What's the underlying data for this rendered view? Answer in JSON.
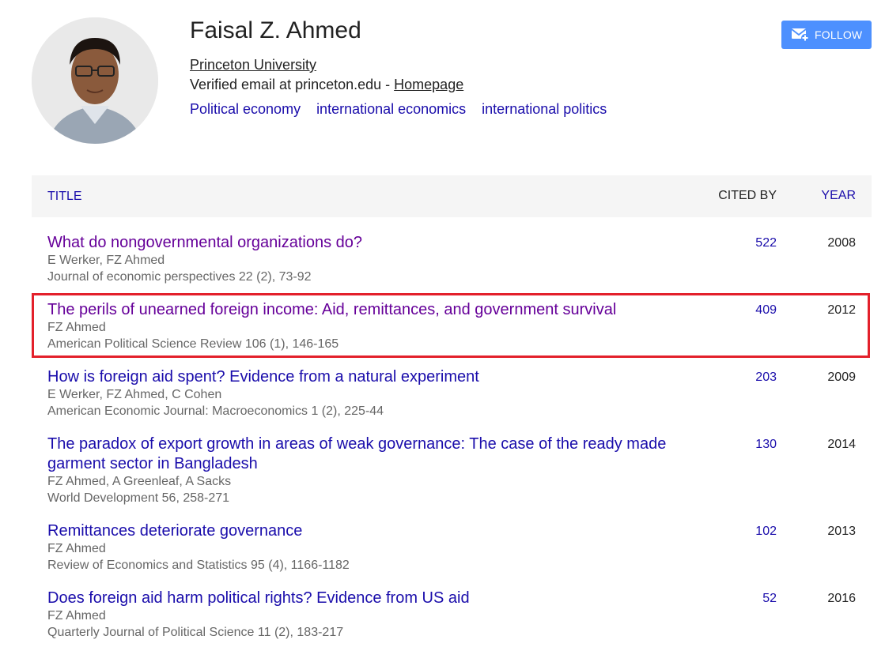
{
  "profile": {
    "name": "Faisal Z. Ahmed",
    "affiliation": "Princeton University",
    "email_text": "Verified email at princeton.edu - ",
    "homepage_label": "Homepage",
    "interests": [
      "Political economy",
      "international economics",
      "international politics"
    ]
  },
  "follow_button": {
    "label": "FOLLOW",
    "icon": "mail-plus-icon",
    "color": "#4d90fe"
  },
  "table": {
    "headers": {
      "title": "TITLE",
      "cited_by": "CITED BY",
      "year": "YEAR"
    },
    "rows": [
      {
        "title": "What do nongovernmental organizations do?",
        "authors": "E Werker, FZ Ahmed",
        "venue": "Journal of economic perspectives 22 (2), 73-92",
        "cited_by": "522",
        "year": "2008"
      },
      {
        "title": "The perils of unearned foreign income: Aid, remittances, and government survival",
        "authors": "FZ Ahmed",
        "venue": "American Political Science Review 106 (1), 146-165",
        "cited_by": "409",
        "year": "2012"
      },
      {
        "title": "How is foreign aid spent? Evidence from a natural experiment",
        "authors": "E Werker, FZ Ahmed, C Cohen",
        "venue": "American Economic Journal: Macroeconomics 1 (2), 225-44",
        "cited_by": "203",
        "year": "2009"
      },
      {
        "title": "The paradox of export growth in areas of weak governance: The case of the ready made garment sector in Bangladesh",
        "authors": "FZ Ahmed, A Greenleaf, A Sacks",
        "venue": "World Development 56, 258-271",
        "cited_by": "130",
        "year": "2014"
      },
      {
        "title": "Remittances deteriorate governance",
        "authors": "FZ Ahmed",
        "venue": "Review of Economics and Statistics 95 (4), 1166-1182",
        "cited_by": "102",
        "year": "2013"
      },
      {
        "title": "Does foreign aid harm political rights? Evidence from US aid",
        "authors": "FZ Ahmed",
        "venue": "Quarterly Journal of Political Science 11 (2), 183-217",
        "cited_by": "52",
        "year": "2016"
      }
    ]
  },
  "colors": {
    "link": "#1a0dab",
    "visited": "#660099",
    "highlight": "#e3202b"
  }
}
